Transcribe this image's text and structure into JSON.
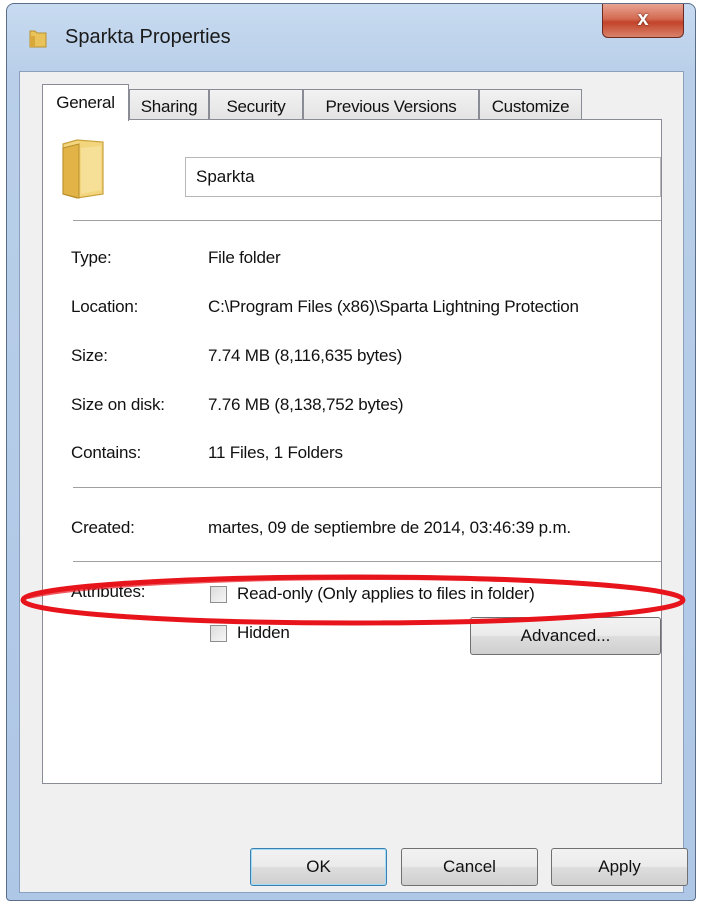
{
  "window": {
    "title": "Sparkta Properties",
    "close_label": "x"
  },
  "tabs": [
    {
      "label": "General",
      "active": true
    },
    {
      "label": "Sharing",
      "active": false
    },
    {
      "label": "Security",
      "active": false
    },
    {
      "label": "Previous Versions",
      "active": false
    },
    {
      "label": "Customize",
      "active": false
    }
  ],
  "general": {
    "name_value": "Sparkta",
    "rows": [
      {
        "label": "Type:",
        "value": "File folder"
      },
      {
        "label": "Location:",
        "value": "C:\\Program Files (x86)\\Sparta Lightning Protection"
      },
      {
        "label": "Size:",
        "value": "7.74 MB (8,116,635 bytes)"
      },
      {
        "label": "Size on disk:",
        "value": "7.76 MB (8,138,752 bytes)"
      },
      {
        "label": "Contains:",
        "value": "11 Files, 1 Folders"
      }
    ],
    "created": {
      "label": "Created:",
      "value": "martes, 09 de septiembre de 2014, 03:46:39 p.m."
    },
    "attributes": {
      "label": "Attributes:",
      "readonly_label": "Read-only (Only applies to files in folder)",
      "readonly_checked": false,
      "hidden_label": "Hidden",
      "hidden_checked": false,
      "advanced_label": "Advanced..."
    }
  },
  "buttons": {
    "ok": "OK",
    "cancel": "Cancel",
    "apply": "Apply"
  },
  "colors": {
    "annotation_ring": "#e8141c",
    "close_button": "#c7432a"
  }
}
